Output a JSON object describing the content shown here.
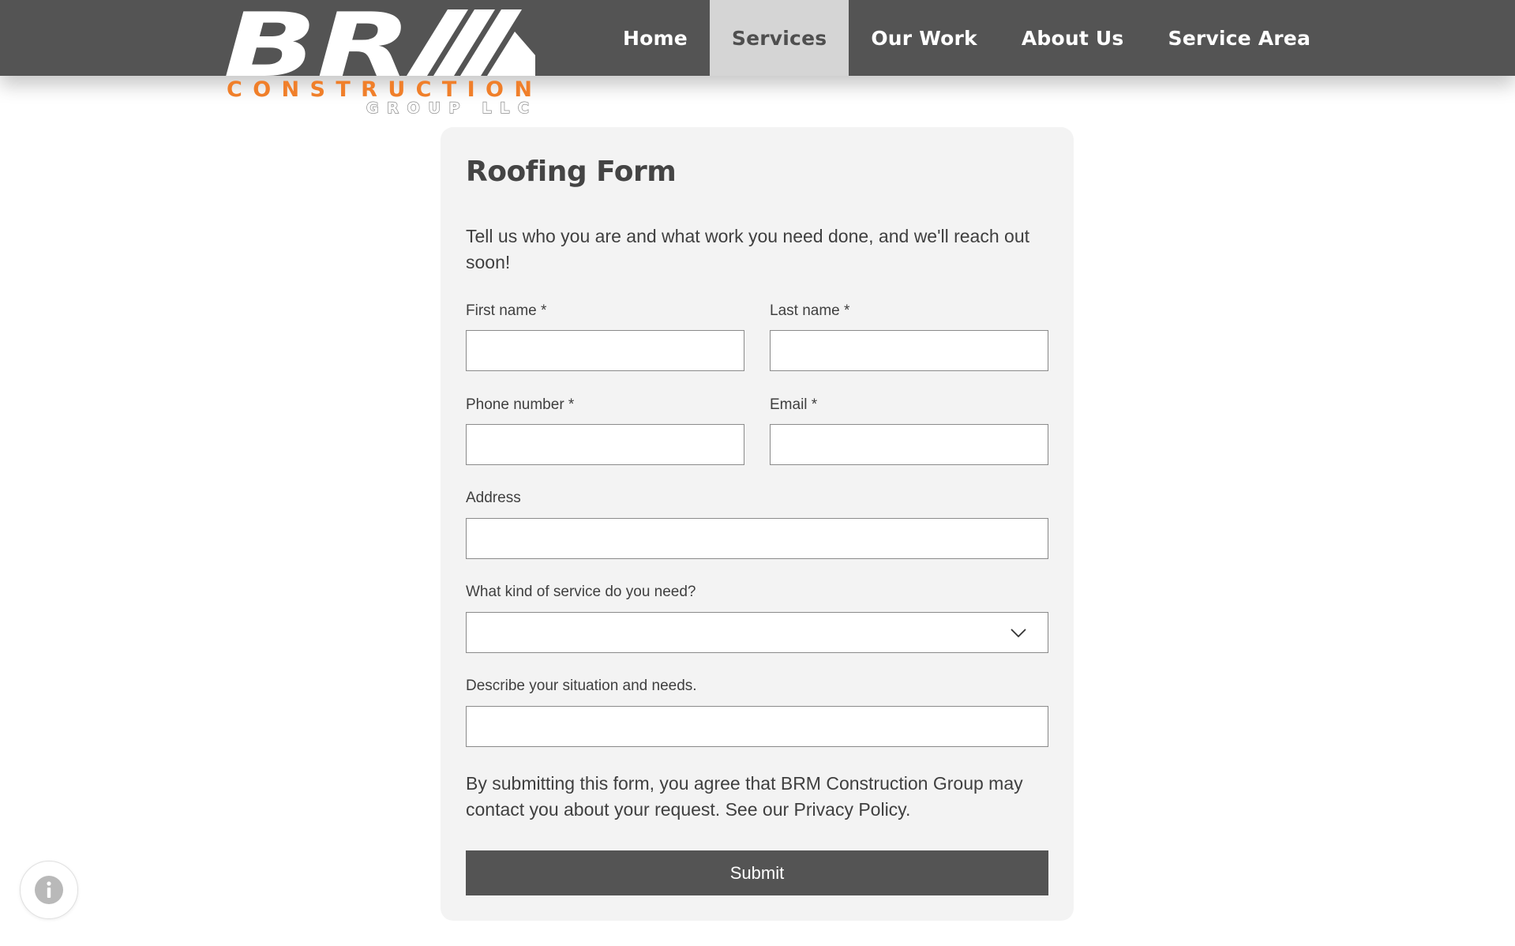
{
  "logo": {
    "main_text": "BR",
    "construction_text": "CONSTRUCTION",
    "group_text": "GROUP LLC",
    "accent_color": "#f07f2a"
  },
  "nav": {
    "items": [
      {
        "label": "Home",
        "active": false
      },
      {
        "label": "Services",
        "active": true
      },
      {
        "label": "Our Work",
        "active": false
      },
      {
        "label": "About Us",
        "active": false
      },
      {
        "label": "Service Area",
        "active": false
      }
    ]
  },
  "form": {
    "title": "Roofing Form",
    "description": "Tell us who you are and what work you need done, and we'll reach out soon!",
    "fields": {
      "first_name": {
        "label": "First name *",
        "value": ""
      },
      "last_name": {
        "label": "Last name *",
        "value": ""
      },
      "phone": {
        "label": "Phone number *",
        "value": ""
      },
      "email": {
        "label": "Email *",
        "value": ""
      },
      "address": {
        "label": "Address",
        "value": ""
      },
      "service": {
        "label": "What kind of service do you need?",
        "value": ""
      },
      "description": {
        "label": "Describe your situation and needs.",
        "value": ""
      }
    },
    "legal": "By submitting this form, you agree that BRM Construction Group may contact you about your request. See our Privacy Policy.",
    "submit_label": "Submit"
  },
  "colors": {
    "header_bg": "#545454",
    "nav_active_bg": "#d5d5d5",
    "card_bg": "#f3f3f3",
    "button_bg": "#545454"
  },
  "icons": [
    "logo-slash-mark",
    "chevron-down-icon",
    "info-icon"
  ]
}
